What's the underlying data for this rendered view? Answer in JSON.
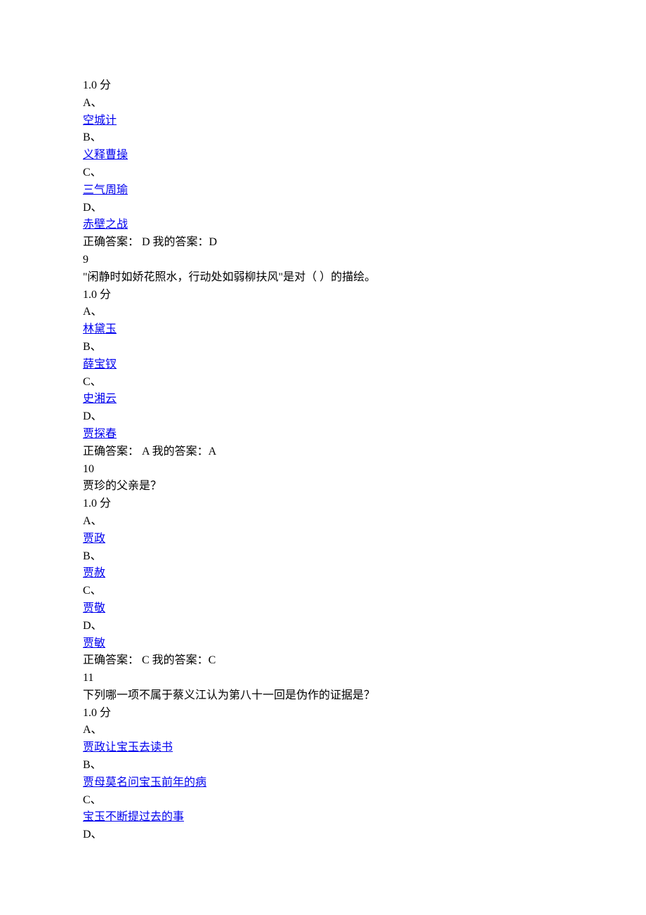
{
  "q8": {
    "points": "1.0 分",
    "labelA": "A、",
    "optA": "空城计",
    "labelB": "B、",
    "optB": "义释曹操",
    "labelC": "C、",
    "optC": "三气周瑜",
    "labelD": "D、",
    "optD": "赤壁之战",
    "answer": "正确答案： D 我的答案：D"
  },
  "q9": {
    "number": "9",
    "stem": "\"闲静时如娇花照水，行动处如弱柳扶风\"是对（ ）的描绘。",
    "points": "1.0 分",
    "labelA": "A、",
    "optA": "林黛玉",
    "labelB": "B、",
    "optB": "薛宝钗",
    "labelC": "C、",
    "optC": "史湘云",
    "labelD": "D、",
    "optD": "贾探春",
    "answer": "正确答案： A 我的答案：A"
  },
  "q10": {
    "number": "10",
    "stem": "贾珍的父亲是？",
    "points": "1.0 分",
    "labelA": "A、",
    "optA": "贾政",
    "labelB": "B、",
    "optB": "贾赦",
    "labelC": "C、",
    "optC": "贾敬",
    "labelD": "D、",
    "optD": "贾敏",
    "answer": "正确答案： C 我的答案：C"
  },
  "q11": {
    "number": "11",
    "stem": "下列哪一项不属于蔡义江认为第八十一回是伪作的证据是？",
    "points": "1.0 分",
    "labelA": "A、",
    "optA": "贾政让宝玉去读书",
    "labelB": "B、",
    "optB": "贾母莫名问宝玉前年的病",
    "labelC": "C、",
    "optC": "宝玉不断提过去的事",
    "labelD": "D、"
  }
}
